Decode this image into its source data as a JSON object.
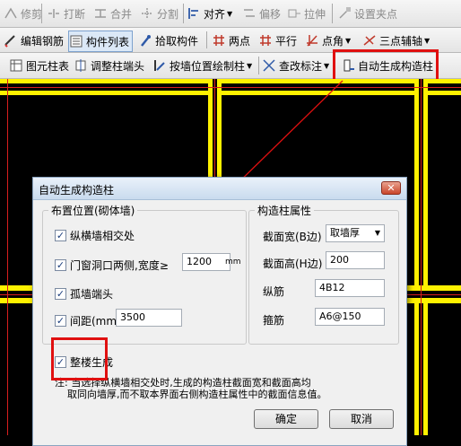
{
  "toolbar1": {
    "items": [
      {
        "label": "修剪",
        "icon": "trim-icon",
        "disabled": true
      },
      {
        "label": "打断",
        "icon": "break-icon",
        "disabled": true
      },
      {
        "label": "合并",
        "icon": "merge-icon",
        "disabled": true
      },
      {
        "label": "分割",
        "icon": "split-icon",
        "disabled": true
      },
      {
        "label": "对齐",
        "icon": "align-icon",
        "disabled": false
      },
      {
        "label": "偏移",
        "icon": "offset-icon",
        "disabled": true
      },
      {
        "label": "拉伸",
        "icon": "stretch-icon",
        "disabled": true
      },
      {
        "label": "设置夹点",
        "icon": "grip-icon",
        "disabled": true
      }
    ]
  },
  "toolbar2": {
    "items": [
      {
        "label": "编辑钢筋",
        "icon": "edit-rebar-icon"
      },
      {
        "label": "构件列表",
        "icon": "component-list-icon"
      },
      {
        "label": "拾取构件",
        "icon": "pick-component-icon"
      },
      {
        "label": "两点",
        "icon": "two-point-icon"
      },
      {
        "label": "平行",
        "icon": "parallel-icon"
      },
      {
        "label": "点角",
        "icon": "point-angle-icon"
      },
      {
        "label": "三点辅轴",
        "icon": "three-point-axis-icon"
      }
    ]
  },
  "toolbar3": {
    "items": [
      {
        "label": "图元柱表",
        "icon": "column-table-icon"
      },
      {
        "label": "调整柱端头",
        "icon": "adjust-column-end-icon"
      },
      {
        "label": "按墙位置绘制柱",
        "icon": "draw-column-by-wall-icon"
      },
      {
        "label": "查改标注",
        "icon": "edit-annotation-icon"
      },
      {
        "label": "自动生成构造柱",
        "icon": "auto-generate-column-icon"
      }
    ]
  },
  "dialog": {
    "title": "自动生成构造柱",
    "placement": {
      "legend": "布置位置(砌体墙)",
      "opt_intersection": "纵横墙相交处",
      "opt_opening": "门窗洞口两侧,宽度≥",
      "opening_width": "1200",
      "opening_unit": "mm",
      "opt_isolated": "孤墙端头",
      "opt_spacing": "间距(mm)",
      "spacing_value": "3500"
    },
    "properties": {
      "legend": "构造柱属性",
      "width_label": "截面宽(B边)",
      "width_value": "取墙厚",
      "height_label": "截面高(H边)",
      "height_value": "200",
      "long_rebar_label": "纵筋",
      "long_rebar_value": "4B12",
      "stirrup_label": "箍筋",
      "stirrup_value": "A6@150"
    },
    "whole_building": "整楼生成",
    "note_line1": "注: 当选择纵横墙相交处时,生成的构造柱截面宽和截面高均",
    "note_line2": "    取同向墙厚,而不取本界面右侧构造柱属性中的截面信息值。",
    "ok": "确定",
    "cancel": "取消"
  },
  "colors": {
    "wall": "#fff100",
    "annotation": "#e01010",
    "canvas": "#000000"
  }
}
